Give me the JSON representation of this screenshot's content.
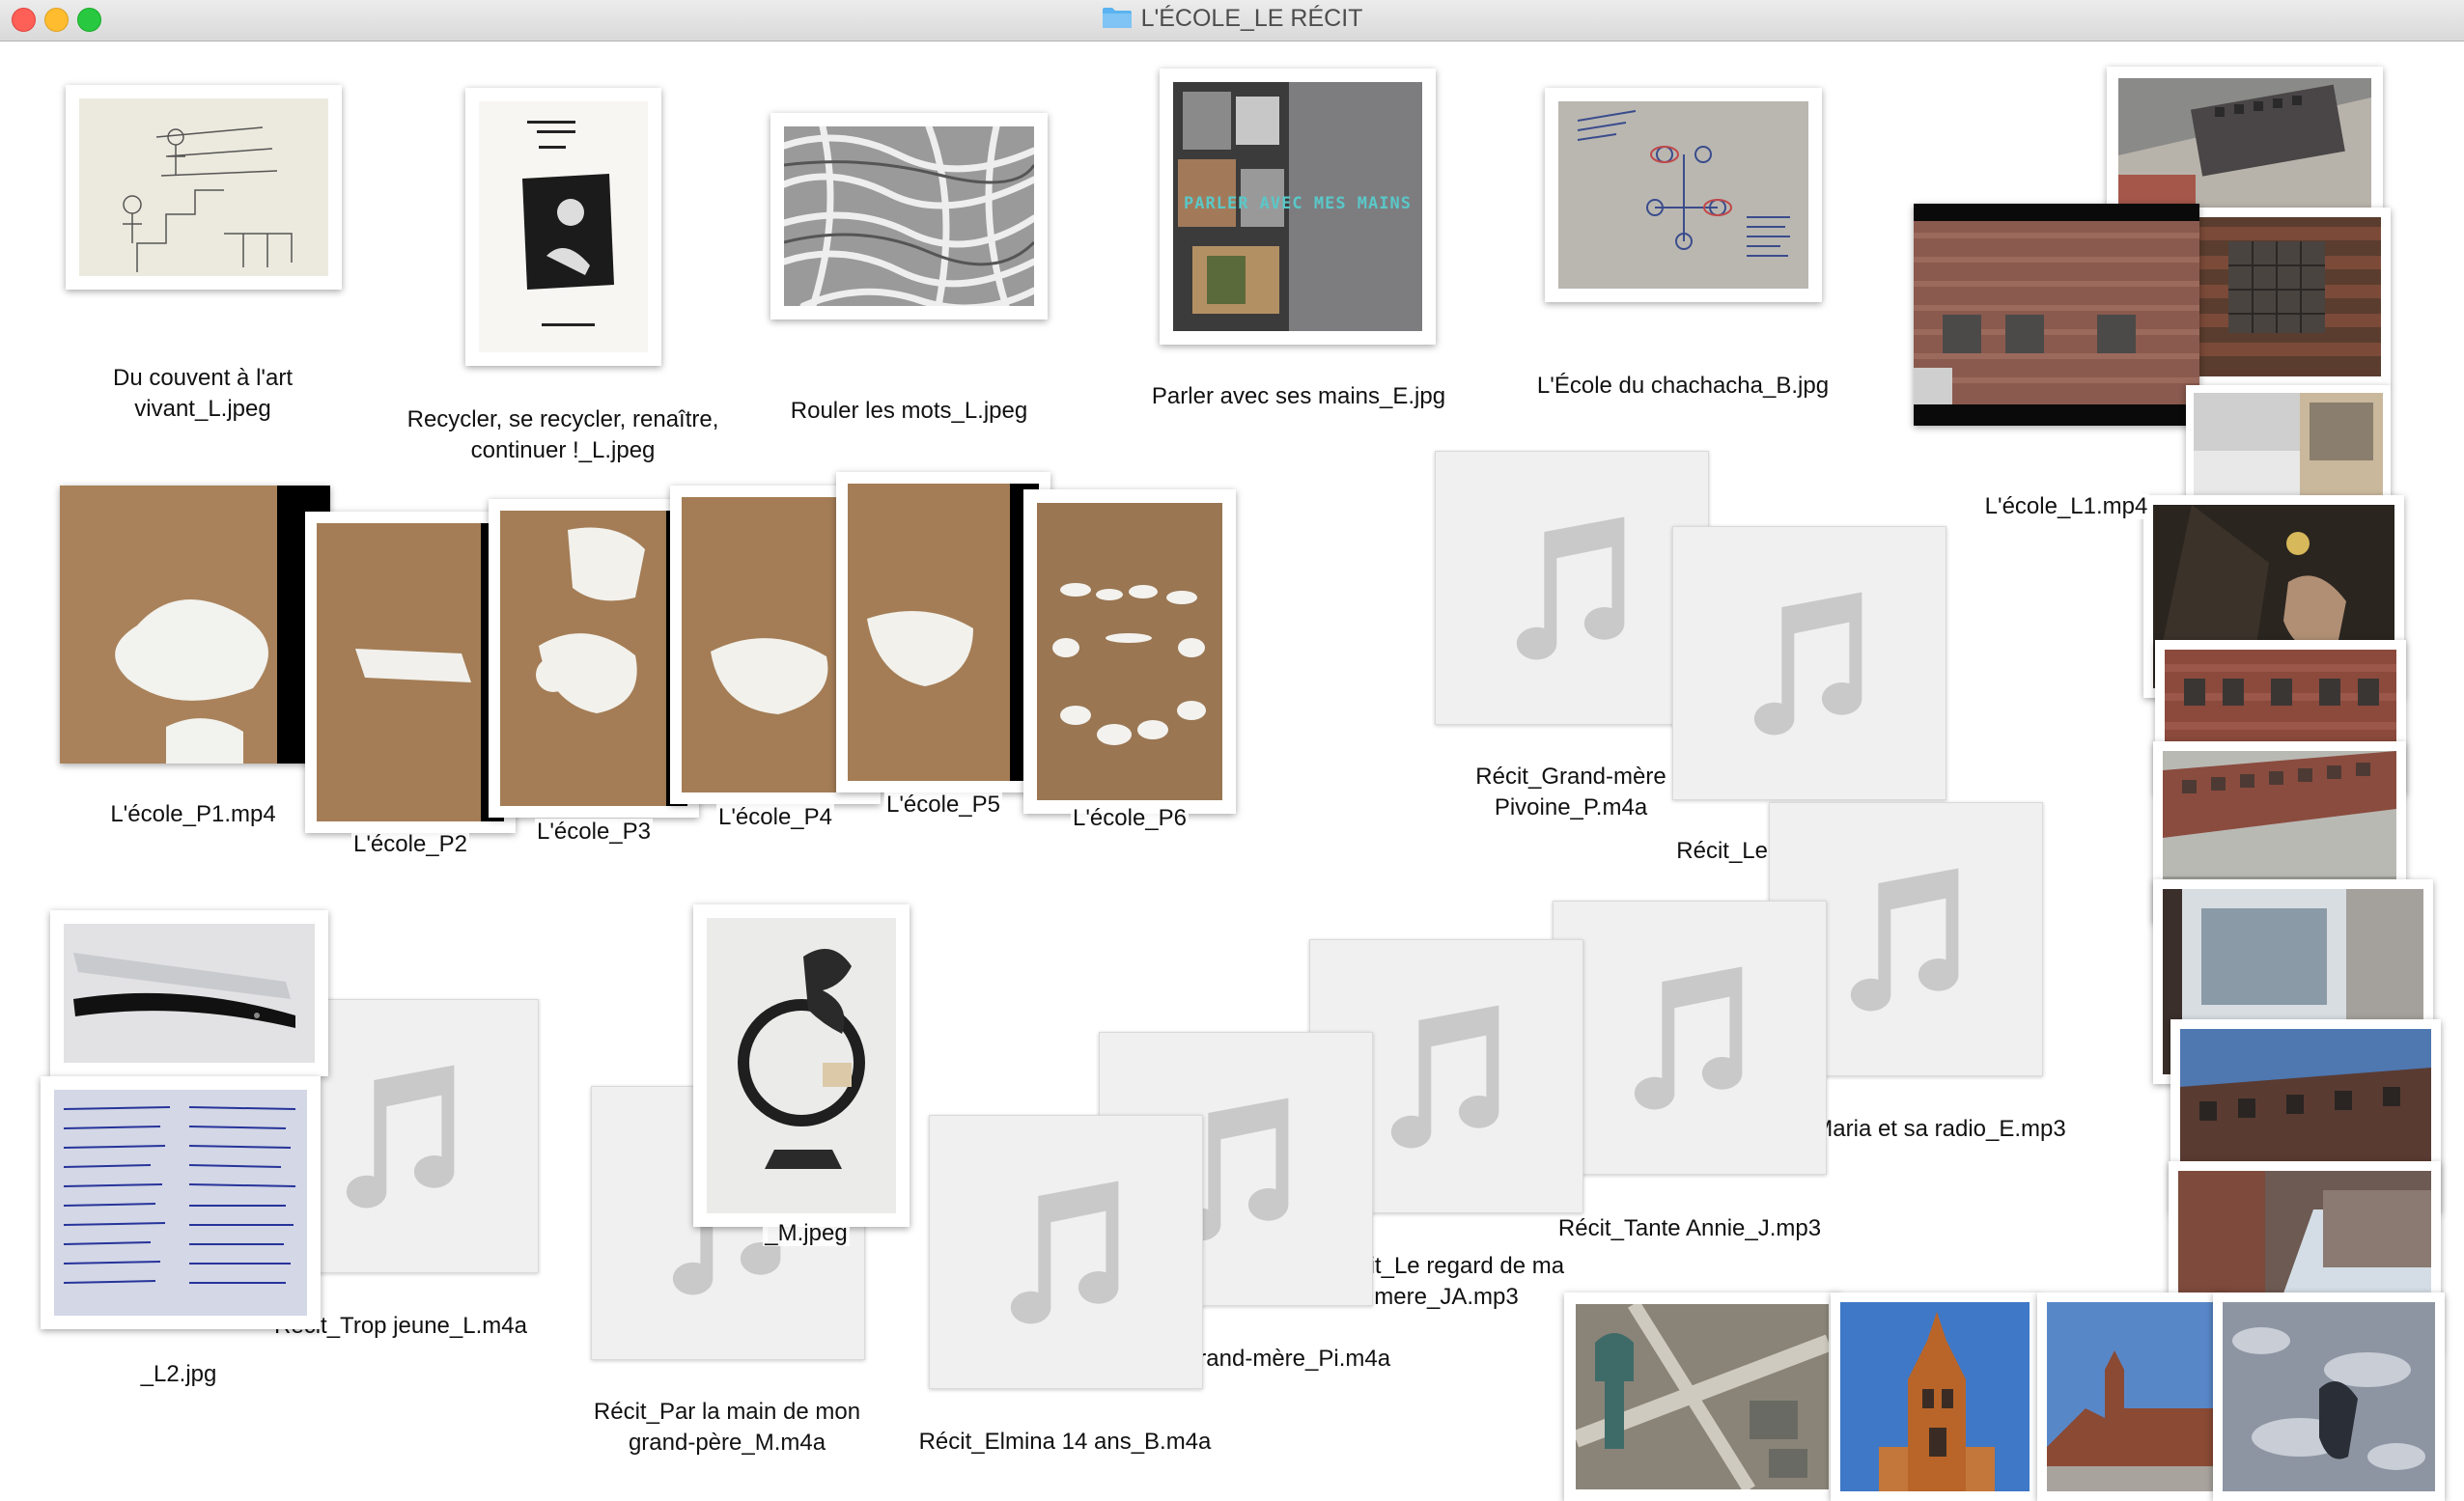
{
  "window": {
    "title": "L'ÉCOLE_LE RÉCIT",
    "folder_icon": "folder-icon",
    "accent": "#5ab3f0"
  },
  "files": {
    "du_couvent": {
      "name_l1": "Du couvent à l'art",
      "name_l2": "vivant_L.jpeg",
      "icon": "image-thumbnail"
    },
    "recycler": {
      "name_l1": "Recycler, se recycler, renaître,",
      "name_l2": "continuer !_L.jpeg",
      "icon": "image-thumbnail"
    },
    "rouler": {
      "name": "Rouler les mots_L.jpeg",
      "icon": "image-thumbnail"
    },
    "parler": {
      "name": "Parler avec ses mains_E.jpg",
      "icon": "image-thumbnail",
      "overlay_text": "PARLER AVEC MES MAINS"
    },
    "chachacha": {
      "name": "L'École du chachacha_B.jpg",
      "icon": "image-thumbnail"
    },
    "ecole_l1": {
      "name": "L'école_L1.mp4",
      "icon": "video-thumbnail"
    },
    "ecole_p1": {
      "name": "L'école_P1.mp4",
      "icon": "video-thumbnail"
    },
    "ecole_p2": {
      "name": "L'école_P2",
      "icon": "image-thumbnail"
    },
    "ecole_p3": {
      "name": "L'école_P3",
      "icon": "image-thumbnail"
    },
    "ecole_p4": {
      "name": "L'école_P4",
      "icon": "image-thumbnail"
    },
    "ecole_p5": {
      "name": "L'école_P5",
      "icon": "image-thumbnail"
    },
    "ecole_p6": {
      "name": "L'école_P6",
      "icon": "image-thumbnail"
    },
    "grand_mere_pivoine": {
      "name_l1": "Récit_Grand-mère",
      "name_l2": "Pivoine_P.m4a",
      "icon": "music-note-icon"
    },
    "phenix": {
      "name": "Récit_Le Phenix_MJ.mp3",
      "icon": "music-note-icon"
    },
    "maria": {
      "name": "Récit_Maria et sa radio_E.mp3",
      "icon": "music-note-icon"
    },
    "tante_annie": {
      "name": "Récit_Tante Annie_J.mp3",
      "icon": "music-note-icon"
    },
    "regard": {
      "name_l1": "Récit_Le regard de ma",
      "name_l2": "mere_JA.mp3",
      "icon": "music-note-icon"
    },
    "ma_grand_mere": {
      "name": "Récit_Ma grand-mère_Pi.m4a",
      "icon": "music-note-icon"
    },
    "elmina": {
      "name": "Récit_Elmina 14 ans_B.m4a",
      "icon": "music-note-icon"
    },
    "par_la_main": {
      "name_l1": "Récit_Par la main de mon",
      "name_l2": "grand-père_M.m4a",
      "icon": "music-note-icon"
    },
    "m_jpeg": {
      "name": "_M.jpeg",
      "icon": "image-thumbnail"
    },
    "trop_jeune": {
      "name": "Récit_Trop jeune_L.m4a",
      "icon": "music-note-icon"
    },
    "l2_jpg": {
      "name": "_L2.jpg",
      "icon": "image-thumbnail"
    }
  }
}
